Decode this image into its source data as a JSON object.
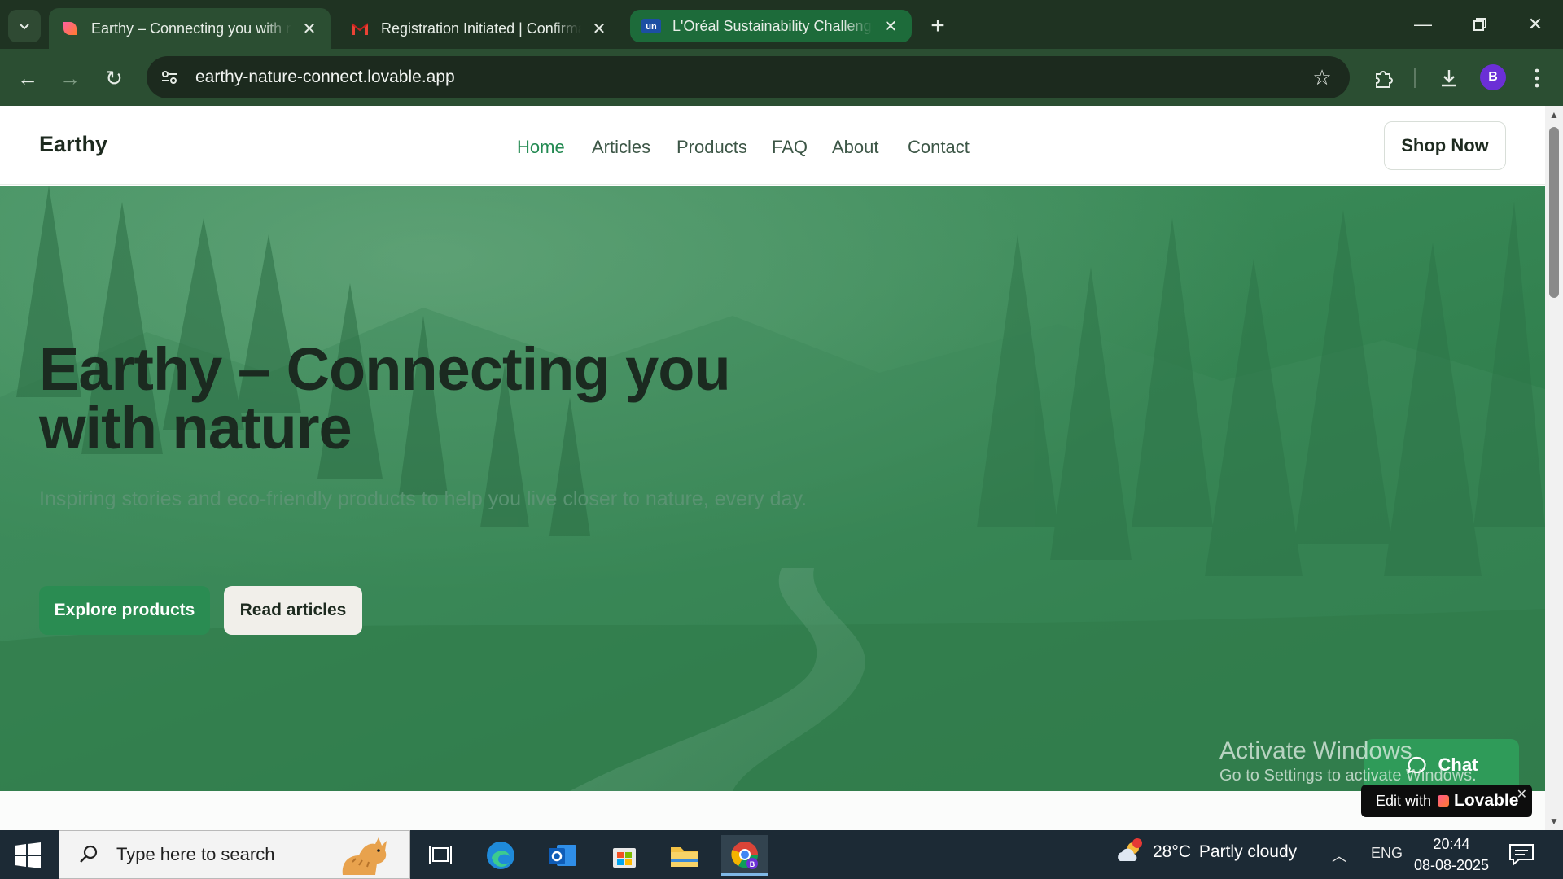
{
  "browser": {
    "tabs": [
      {
        "title": "Earthy – Connecting you with nature",
        "favicon": "lovable-heart-icon",
        "active": true
      },
      {
        "title": "Registration Initiated | Confirmation",
        "favicon": "gmail-icon",
        "active": false
      },
      {
        "title": "L'Oréal Sustainability Challenge",
        "favicon": "unstop-icon",
        "active": false
      }
    ],
    "url": "earthy-nature-connect.lovable.app",
    "profile_initial": "B",
    "accent": "#2b4e32"
  },
  "site": {
    "logo": "Earthy",
    "nav": [
      "Home",
      "Articles",
      "Products",
      "FAQ",
      "About",
      "Contact"
    ],
    "active_nav": "Home",
    "cta": "Shop Now",
    "hero": {
      "title": "Earthy – Connecting you with nature",
      "subtitle": "Inspiring stories and eco-friendly products to help you live closer to nature, every day.",
      "primary_button": "Explore products",
      "secondary_button": "Read articles"
    },
    "chat_label": "Chat",
    "badge": {
      "prefix": "Edit with",
      "brand": "Lovable"
    },
    "brand_green": "#2a8c52"
  },
  "watermark": {
    "line1": "Activate Windows",
    "line2": "Go to Settings to activate Windows."
  },
  "taskbar": {
    "search_placeholder": "Type here to search",
    "weather": {
      "temp": "28°C",
      "condition": "Partly cloudy",
      "alert_count": "1"
    },
    "language": "ENG",
    "time": "20:44",
    "date": "08-08-2025"
  }
}
